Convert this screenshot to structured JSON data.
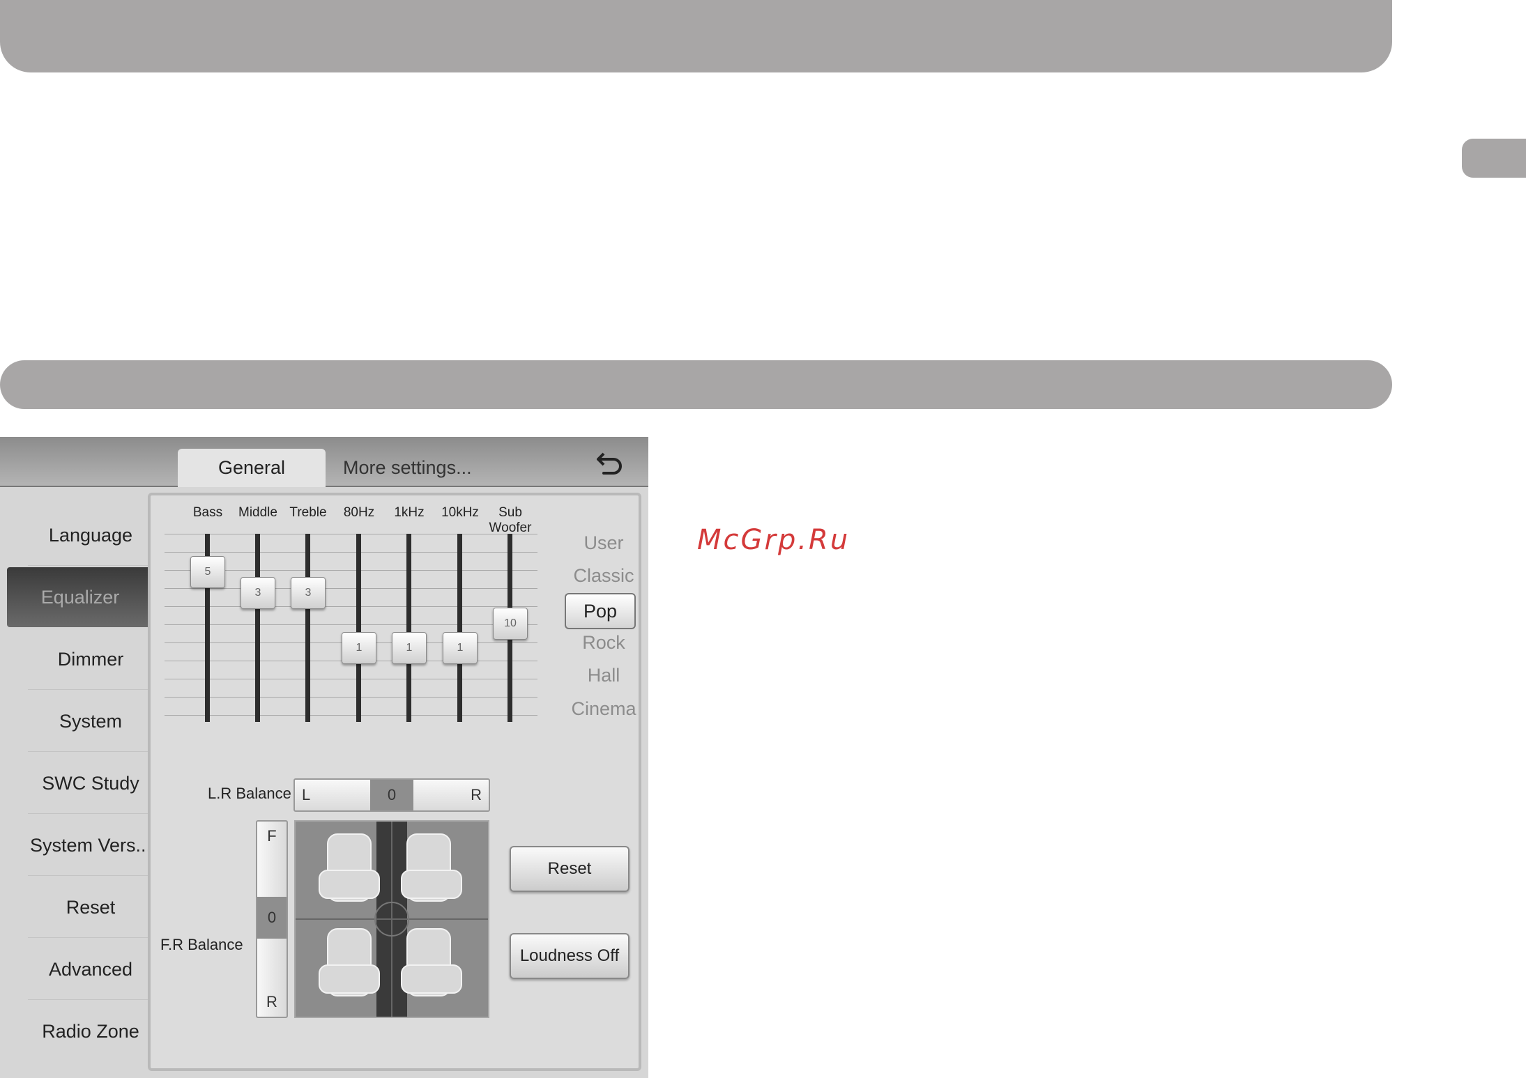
{
  "watermark": "McGrp.Ru",
  "tabs": {
    "general": "General",
    "more": "More settings..."
  },
  "sidebar": {
    "items": [
      {
        "label": "Language"
      },
      {
        "label": "Equalizer"
      },
      {
        "label": "Dimmer"
      },
      {
        "label": "System"
      },
      {
        "label": "SWC Study"
      },
      {
        "label": "System Vers..."
      },
      {
        "label": "Reset"
      },
      {
        "label": "Advanced"
      },
      {
        "label": "Radio Zone"
      }
    ],
    "active": "Equalizer"
  },
  "equalizer": {
    "bands": [
      {
        "label": "Bass",
        "value": "5"
      },
      {
        "label": "Middle",
        "value": "3"
      },
      {
        "label": "Treble",
        "value": "3"
      },
      {
        "label": "80Hz",
        "value": "1"
      },
      {
        "label": "1kHz",
        "value": "1"
      },
      {
        "label": "10kHz",
        "value": "1"
      },
      {
        "label": "Sub\nWoofer",
        "value": "10"
      }
    ],
    "presets": [
      "User",
      "Classic",
      "Pop",
      "Rock",
      "Hall",
      "Cinema"
    ],
    "active_preset": "Pop"
  },
  "balance": {
    "lr_label": "L.R Balance",
    "lr_left": "L",
    "lr_value": "0",
    "lr_right": "R",
    "fr_label": "F.R Balance",
    "fr_front": "F",
    "fr_value": "0",
    "fr_rear": "R"
  },
  "buttons": {
    "reset": "Reset",
    "loudness": "Loudness Off"
  }
}
